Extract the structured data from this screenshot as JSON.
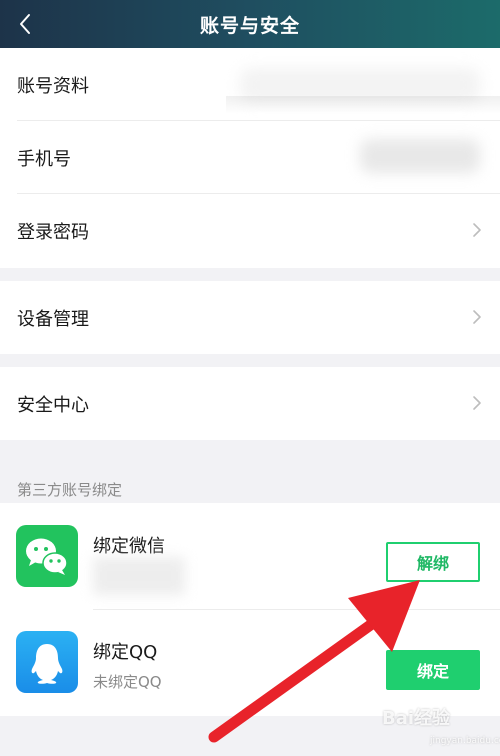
{
  "header": {
    "title": "账号与安全",
    "back_icon": "chevron-left-icon"
  },
  "group1": {
    "items": [
      {
        "label": "账号资料"
      },
      {
        "label": "手机号"
      },
      {
        "label": "登录密码"
      }
    ]
  },
  "group2": {
    "items": [
      {
        "label": "设备管理"
      }
    ]
  },
  "group3": {
    "items": [
      {
        "label": "安全中心"
      }
    ]
  },
  "third_party": {
    "section_title": "第三方账号绑定",
    "items": [
      {
        "title": "绑定微信",
        "subtitle": "",
        "button_label": "解绑",
        "icon": "wechat-icon"
      },
      {
        "title": "绑定QQ",
        "subtitle": "未绑定QQ",
        "button_label": "绑定",
        "icon": "qq-icon"
      }
    ]
  },
  "colors": {
    "accent": "#1fcf6f",
    "header_start": "#1d3349",
    "header_end": "#1c6b6a",
    "arrow": "#e8232a"
  },
  "watermark": {
    "text": "Bai经验",
    "sub": "jingyan.baidu.com"
  }
}
